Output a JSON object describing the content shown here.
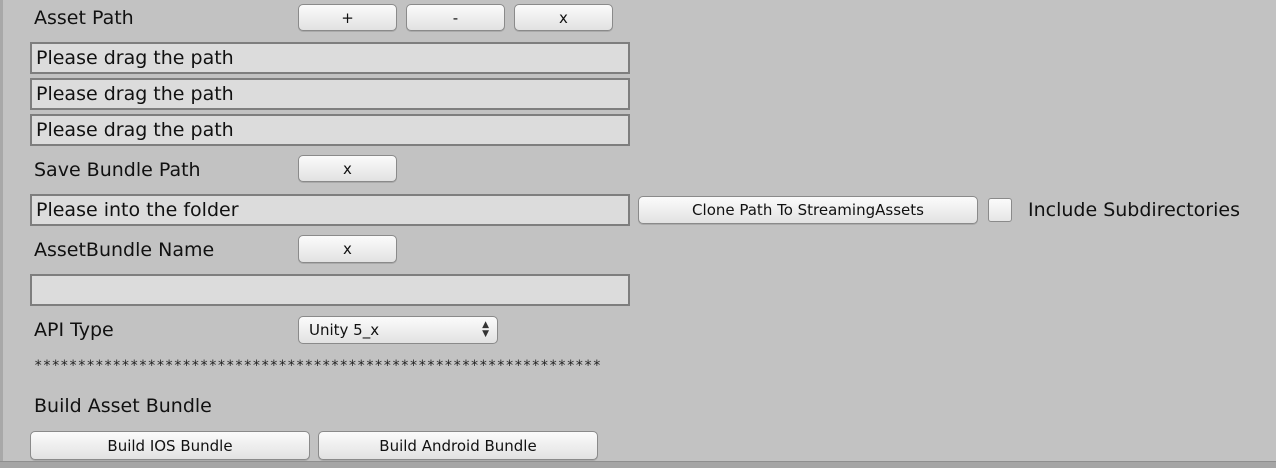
{
  "asset_path": {
    "label": "Asset Path",
    "add_label": "+",
    "remove_label": "-",
    "clear_label": "x",
    "fields": [
      {
        "placeholder": "Please drag the path"
      },
      {
        "placeholder": "Please drag the path"
      },
      {
        "placeholder": "Please drag the path"
      }
    ]
  },
  "save_bundle": {
    "label": "Save Bundle Path",
    "clear_label": "x",
    "field_placeholder": "Please into the folder",
    "clone_label": "Clone Path To StreamingAssets",
    "include_subdirs_label": "Include Subdirectories",
    "include_subdirs_checked": false
  },
  "assetbundle_name": {
    "label": "AssetBundle Name",
    "clear_label": "x",
    "value": ""
  },
  "api_type": {
    "label": "API Type",
    "selected": "Unity 5_x",
    "arrow_icon": "up-down-arrows-icon"
  },
  "separator": "*****************************************************************",
  "build": {
    "label": "Build Asset Bundle",
    "ios_label": "Build IOS Bundle",
    "android_label": "Build Android Bundle"
  }
}
